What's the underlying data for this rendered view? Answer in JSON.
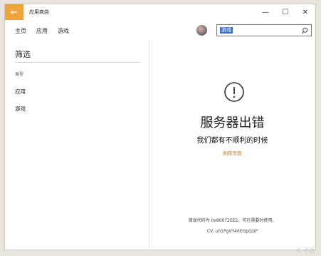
{
  "titlebar": {
    "back_icon": "arrow-left-icon",
    "app_title": "应用商店",
    "minimize": "—",
    "maximize": "☐",
    "close": "✕"
  },
  "navbar": {
    "items": [
      "主页",
      "应用",
      "游戏"
    ],
    "search": {
      "selected_text": "游戏"
    }
  },
  "sidebar": {
    "title": "筛选",
    "subtitle": "类型",
    "items": [
      "应用",
      "游戏"
    ]
  },
  "main": {
    "error_title": "服务器出错",
    "error_subtitle": "我们都有不顺利的时候",
    "refresh": "刷新页面",
    "error_code": "错误代码为 0x80072EE2，可在需要时使用。",
    "cv": "CV: uh1PgVY46EGpQzIF"
  },
  "watermark": "© 子炳",
  "colors": {
    "accent": "#f0a33a",
    "link": "#d07a1e",
    "selection": "#3a6fd8"
  }
}
